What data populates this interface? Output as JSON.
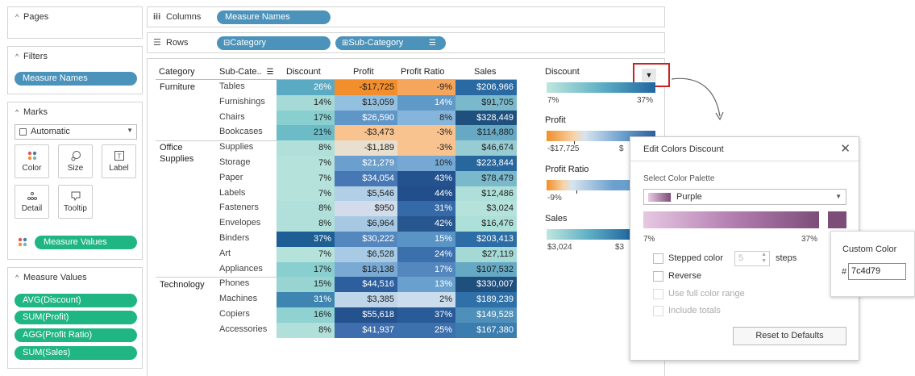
{
  "sidebar": {
    "pages_title": "Pages",
    "filters_title": "Filters",
    "filter_pill": "Measure Names",
    "marks_title": "Marks",
    "mark_type": "Automatic",
    "mark_buttons": {
      "color": "Color",
      "size": "Size",
      "label": "Label",
      "detail": "Detail",
      "tooltip": "Tooltip"
    },
    "measure_values_pill": "Measure Values",
    "measure_values_title": "Measure Values",
    "measures": [
      "AVG(Discount)",
      "SUM(Profit)",
      "AGG(Profit Ratio)",
      "SUM(Sales)"
    ]
  },
  "shelves": {
    "columns_label": "Columns",
    "columns_pill": "Measure Names",
    "rows_label": "Rows",
    "rows_pills": [
      "Category",
      "Sub-Category"
    ]
  },
  "table": {
    "headers": {
      "category": "Category",
      "subcategory": "Sub-Cate..",
      "discount": "Discount",
      "profit": "Profit",
      "profit_ratio": "Profit Ratio",
      "sales": "Sales"
    },
    "categories": [
      {
        "name": "Furniture",
        "start": 0
      },
      {
        "name": "Office\nSupplies",
        "start": 4
      },
      {
        "name": "Technology",
        "start": 13
      }
    ],
    "rows": [
      {
        "sub": "Tables",
        "discount": "26%",
        "profit": "-$17,725",
        "ratio": "-9%",
        "sales": "$206,966"
      },
      {
        "sub": "Furnishings",
        "discount": "14%",
        "profit": "$13,059",
        "ratio": "14%",
        "sales": "$91,705"
      },
      {
        "sub": "Chairs",
        "discount": "17%",
        "profit": "$26,590",
        "ratio": "8%",
        "sales": "$328,449"
      },
      {
        "sub": "Bookcases",
        "discount": "21%",
        "profit": "-$3,473",
        "ratio": "-3%",
        "sales": "$114,880"
      },
      {
        "sub": "Supplies",
        "discount": "8%",
        "profit": "-$1,189",
        "ratio": "-3%",
        "sales": "$46,674"
      },
      {
        "sub": "Storage",
        "discount": "7%",
        "profit": "$21,279",
        "ratio": "10%",
        "sales": "$223,844"
      },
      {
        "sub": "Paper",
        "discount": "7%",
        "profit": "$34,054",
        "ratio": "43%",
        "sales": "$78,479"
      },
      {
        "sub": "Labels",
        "discount": "7%",
        "profit": "$5,546",
        "ratio": "44%",
        "sales": "$12,486"
      },
      {
        "sub": "Fasteners",
        "discount": "8%",
        "profit": "$950",
        "ratio": "31%",
        "sales": "$3,024"
      },
      {
        "sub": "Envelopes",
        "discount": "8%",
        "profit": "$6,964",
        "ratio": "42%",
        "sales": "$16,476"
      },
      {
        "sub": "Binders",
        "discount": "37%",
        "profit": "$30,222",
        "ratio": "15%",
        "sales": "$203,413"
      },
      {
        "sub": "Art",
        "discount": "7%",
        "profit": "$6,528",
        "ratio": "24%",
        "sales": "$27,119"
      },
      {
        "sub": "Appliances",
        "discount": "17%",
        "profit": "$18,138",
        "ratio": "17%",
        "sales": "$107,532"
      },
      {
        "sub": "Phones",
        "discount": "15%",
        "profit": "$44,516",
        "ratio": "13%",
        "sales": "$330,007"
      },
      {
        "sub": "Machines",
        "discount": "31%",
        "profit": "$3,385",
        "ratio": "2%",
        "sales": "$189,239"
      },
      {
        "sub": "Copiers",
        "discount": "16%",
        "profit": "$55,618",
        "ratio": "37%",
        "sales": "$149,528"
      },
      {
        "sub": "Accessories",
        "discount": "8%",
        "profit": "$41,937",
        "ratio": "25%",
        "sales": "$167,380"
      }
    ],
    "cell_colors": {
      "discount": [
        "#5aaac3",
        "#a6dad6",
        "#8acfcf",
        "#6cbcc8",
        "#b0e0d9",
        "#b5e2da",
        "#b5e2da",
        "#b5e2da",
        "#b0e0d9",
        "#b0e0d9",
        "#1d5f94",
        "#b5e2da",
        "#8acfcf",
        "#98d5d2",
        "#3e86b1",
        "#90d2d1",
        "#b0e0d9"
      ],
      "profit": [
        "#f28e2b",
        "#94c0e0",
        "#5f96c8",
        "#f8c38f",
        "#e8dfcf",
        "#6b9fcd",
        "#4778b5",
        "#b1cfe6",
        "#d2dcea",
        "#a6c8e3",
        "#5587bf",
        "#a8cae4",
        "#7aaad4",
        "#2d5f9f",
        "#bfd6ea",
        "#24528f",
        "#3e6eae"
      ],
      "ratio": [
        "#f6a65c",
        "#5f99c8",
        "#86b5db",
        "#f8c38f",
        "#f8c38f",
        "#75a9d4",
        "#24528f",
        "#224e8b",
        "#356aa8",
        "#28568f",
        "#5a93c5",
        "#3b70ad",
        "#5587bf",
        "#6aa0ce",
        "#cbdcec",
        "#2a5b99",
        "#3d71ae"
      ],
      "sales": [
        "#2a6aa3",
        "#79b9cb",
        "#1f4f7d",
        "#66a9c4",
        "#98ccd3",
        "#27679e",
        "#7ab9cb",
        "#aee0d9",
        "#b5e2da",
        "#ade0d8",
        "#2c6da5",
        "#a5d9d5",
        "#66a9c4",
        "#1f4f7d",
        "#2f70a8",
        "#4f90bb",
        "#3b7daf"
      ]
    }
  },
  "legends": {
    "discount": {
      "title": "Discount",
      "min": "7%",
      "max": "37%"
    },
    "profit": {
      "title": "Profit",
      "min": "-$17,725",
      "max": "$"
    },
    "profit_ratio": {
      "title": "Profit Ratio",
      "min": "-9%"
    },
    "sales": {
      "title": "Sales",
      "min": "$3,024",
      "max": "$3"
    }
  },
  "dialog": {
    "title": "Edit Colors Discount",
    "palette_label": "Select Color Palette",
    "palette_value": "Purple",
    "range_min": "7%",
    "range_max": "37%",
    "stepped_label": "Stepped color",
    "steps_value": "5",
    "steps_suffix": "steps",
    "reverse_label": "Reverse",
    "full_range_label": "Use full color range",
    "include_totals_label": "Include totals",
    "reset_label": "Reset to Defaults"
  },
  "custom_color": {
    "title": "Custom Color",
    "hash": "#",
    "value": "7c4d79",
    "swatch": "#7c4d79"
  },
  "colors": {
    "accent_red": "#cc2222",
    "pill_blue": "#4c93bb",
    "pill_green": "#1fb683"
  }
}
